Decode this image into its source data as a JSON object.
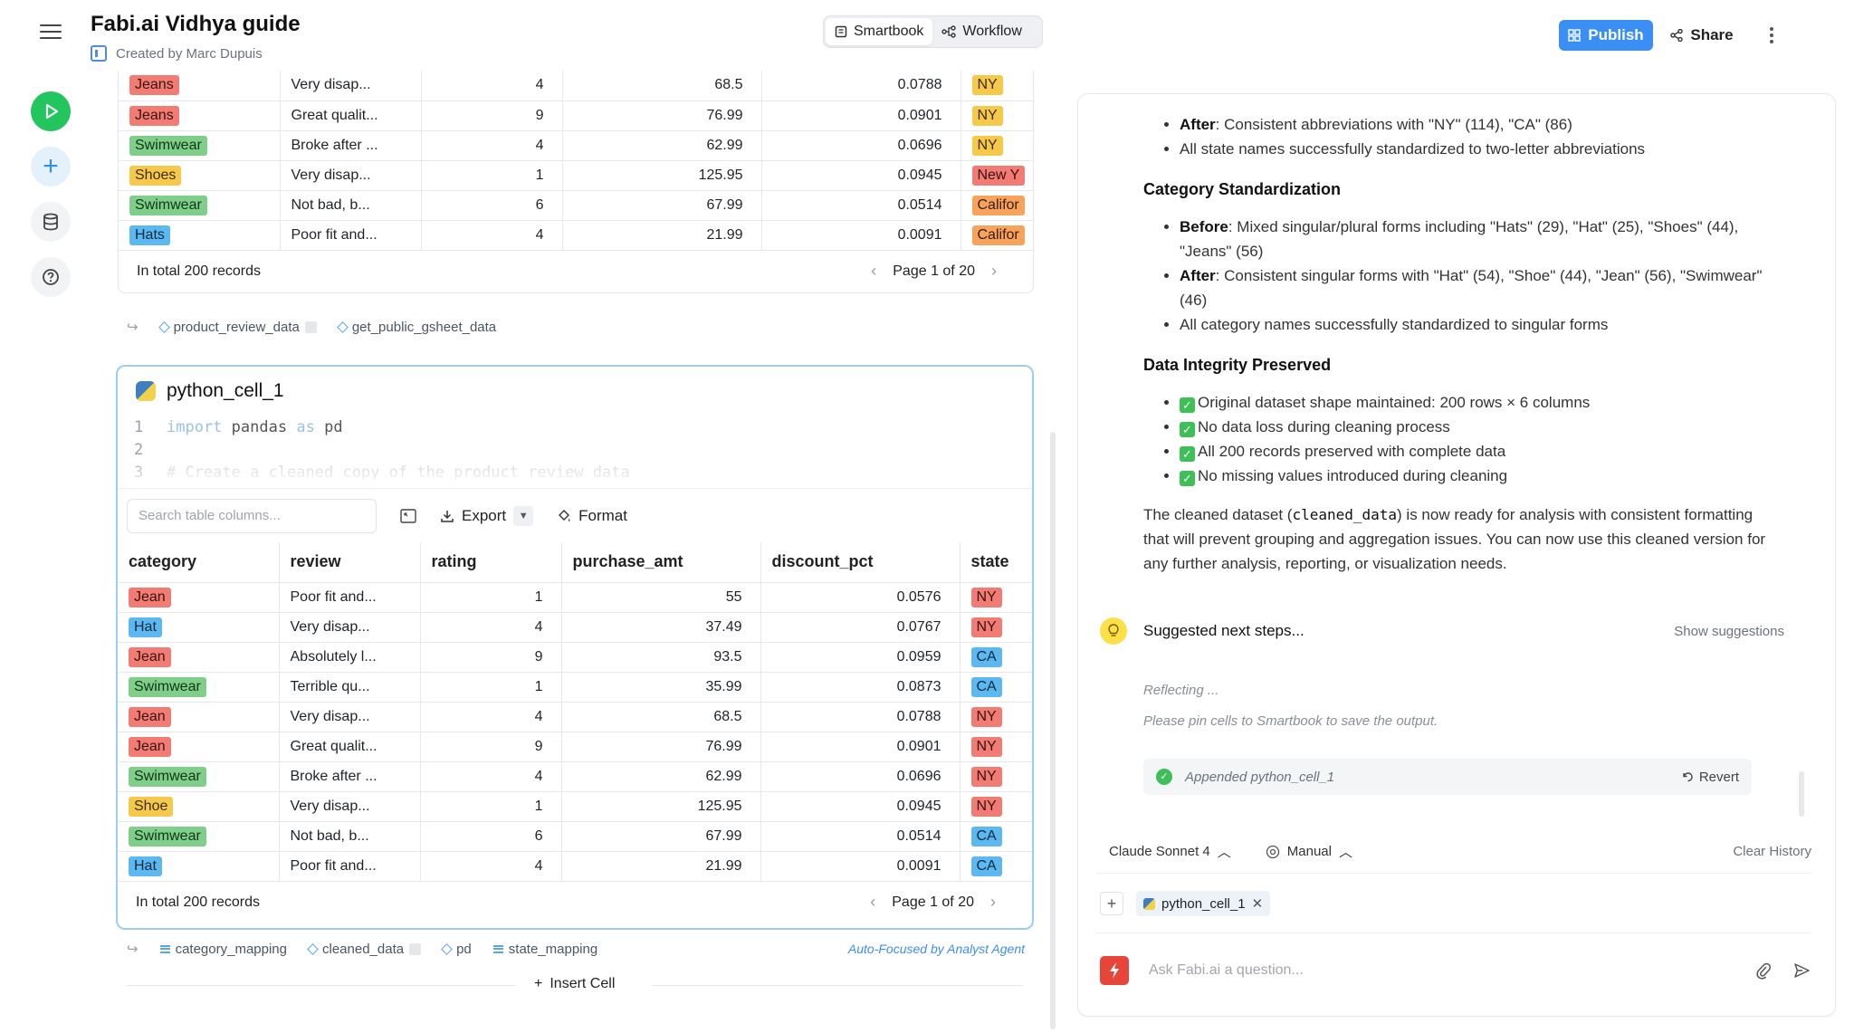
{
  "header": {
    "title": "Fabi.ai Vidhya guide",
    "subtitle": "Created by Marc Dupuis",
    "modes": [
      "Smartbook",
      "Workflow"
    ],
    "publish_label": "Publish",
    "share_label": "Share"
  },
  "top_table": {
    "rows": [
      {
        "category": "Jeans",
        "cat_color": "red",
        "review": "Very disap...",
        "rating": "4",
        "purchase_amt": "68.5",
        "discount_pct": "0.0788",
        "state": "NY",
        "state_color": "yellow"
      },
      {
        "category": "Jeans",
        "cat_color": "red",
        "review": "Great qualit...",
        "rating": "9",
        "purchase_amt": "76.99",
        "discount_pct": "0.0901",
        "state": "NY",
        "state_color": "yellow"
      },
      {
        "category": "Swimwear",
        "cat_color": "green",
        "review": "Broke after ...",
        "rating": "4",
        "purchase_amt": "62.99",
        "discount_pct": "0.0696",
        "state": "NY",
        "state_color": "yellow"
      },
      {
        "category": "Shoes",
        "cat_color": "yellow",
        "review": "Very disap...",
        "rating": "1",
        "purchase_amt": "125.95",
        "discount_pct": "0.0945",
        "state": "New Y",
        "state_color": "red"
      },
      {
        "category": "Swimwear",
        "cat_color": "green",
        "review": "Not bad, b...",
        "rating": "6",
        "purchase_amt": "67.99",
        "discount_pct": "0.0514",
        "state": "Califor",
        "state_color": "orange"
      },
      {
        "category": "Hats",
        "cat_color": "blue",
        "review": "Poor fit and...",
        "rating": "4",
        "purchase_amt": "21.99",
        "discount_pct": "0.0091",
        "state": "Califor",
        "state_color": "orange"
      }
    ],
    "total": "In total 200 records",
    "page": "Page 1 of 20"
  },
  "top_deps": [
    "product_review_data",
    "get_public_gsheet_data"
  ],
  "cell": {
    "name": "python_cell_1",
    "code_line1_kw": "import",
    "code_line1_id": "pandas",
    "code_line1_kw2": "as",
    "code_line1_id2": "pd",
    "code_line3": "# Create a cleaned copy of the product review data",
    "line_numbers": [
      "1",
      "2",
      "3"
    ],
    "search_placeholder": "Search table columns...",
    "export_label": "Export",
    "format_label": "Format",
    "columns": [
      "category",
      "review",
      "rating",
      "purchase_amt",
      "discount_pct",
      "state"
    ],
    "rows": [
      {
        "category": "Jean",
        "cat_color": "red",
        "review": "Poor fit and...",
        "rating": "1",
        "purchase_amt": "55",
        "discount_pct": "0.0576",
        "state": "NY",
        "state_color": "red"
      },
      {
        "category": "Hat",
        "cat_color": "blue",
        "review": "Very disap...",
        "rating": "4",
        "purchase_amt": "37.49",
        "discount_pct": "0.0767",
        "state": "NY",
        "state_color": "red"
      },
      {
        "category": "Jean",
        "cat_color": "red",
        "review": "Absolutely l...",
        "rating": "9",
        "purchase_amt": "93.5",
        "discount_pct": "0.0959",
        "state": "CA",
        "state_color": "blue"
      },
      {
        "category": "Swimwear",
        "cat_color": "green",
        "review": "Terrible qu...",
        "rating": "1",
        "purchase_amt": "35.99",
        "discount_pct": "0.0873",
        "state": "CA",
        "state_color": "blue"
      },
      {
        "category": "Jean",
        "cat_color": "red",
        "review": "Very disap...",
        "rating": "4",
        "purchase_amt": "68.5",
        "discount_pct": "0.0788",
        "state": "NY",
        "state_color": "red"
      },
      {
        "category": "Jean",
        "cat_color": "red",
        "review": "Great qualit...",
        "rating": "9",
        "purchase_amt": "76.99",
        "discount_pct": "0.0901",
        "state": "NY",
        "state_color": "red"
      },
      {
        "category": "Swimwear",
        "cat_color": "green",
        "review": "Broke after ...",
        "rating": "4",
        "purchase_amt": "62.99",
        "discount_pct": "0.0696",
        "state": "NY",
        "state_color": "red"
      },
      {
        "category": "Shoe",
        "cat_color": "yellow",
        "review": "Very disap...",
        "rating": "1",
        "purchase_amt": "125.95",
        "discount_pct": "0.0945",
        "state": "NY",
        "state_color": "red"
      },
      {
        "category": "Swimwear",
        "cat_color": "green",
        "review": "Not bad, b...",
        "rating": "6",
        "purchase_amt": "67.99",
        "discount_pct": "0.0514",
        "state": "CA",
        "state_color": "blue"
      },
      {
        "category": "Hat",
        "cat_color": "blue",
        "review": "Poor fit and...",
        "rating": "4",
        "purchase_amt": "21.99",
        "discount_pct": "0.0091",
        "state": "CA",
        "state_color": "blue"
      }
    ],
    "total": "In total 200 records",
    "page": "Page 1 of 20"
  },
  "cell_deps": [
    "category_mapping",
    "cleaned_data",
    "pd",
    "state_mapping"
  ],
  "auto_focused": "Auto-Focused by Analyst Agent",
  "insert_cell": "Insert Cell",
  "chat": {
    "after_state_b": "After",
    "after_state_t": ": Consistent abbreviations with \"NY\" (114), \"CA\" (86)",
    "state_done": "All state names successfully standardized to two-letter abbreviations",
    "h_category": "Category Standardization",
    "before_b": "Before",
    "before_t": ": Mixed singular/plural forms including \"Hats\" (29), \"Hat\" (25), \"Shoes\" (44), \"Jeans\" (56)",
    "after_cat_b": "After",
    "after_cat_t": ": Consistent singular forms with \"Hat\" (54), \"Shoe\" (44), \"Jean\" (56), \"Swimwear\" (46)",
    "cat_done": "All category names successfully standardized to singular forms",
    "h_integrity": "Data Integrity Preserved",
    "checks": [
      "Original dataset shape maintained: 200 rows × 6 columns",
      "No data loss during cleaning process",
      "All 200 records preserved with complete data",
      "No missing values introduced during cleaning"
    ],
    "summary_pre": "The cleaned dataset (",
    "summary_code": "cleaned_data",
    "summary_post": ") is now ready for analysis with consistent formatting that will prevent grouping and aggregation issues. You can now use this cleaned version for any further analysis, reporting, or visualization needs.",
    "suggested": "Suggested next steps...",
    "show_suggestions": "Show suggestions",
    "reflecting": "Reflecting ...",
    "pin_note": "Please pin cells to Smartbook to save the output.",
    "appended": "Appended python_cell_1",
    "revert": "Revert",
    "model": "Claude Sonnet 4",
    "mode": "Manual",
    "clear_history": "Clear History",
    "chip": "python_cell_1",
    "ask_placeholder": "Ask Fabi.ai a question..."
  }
}
